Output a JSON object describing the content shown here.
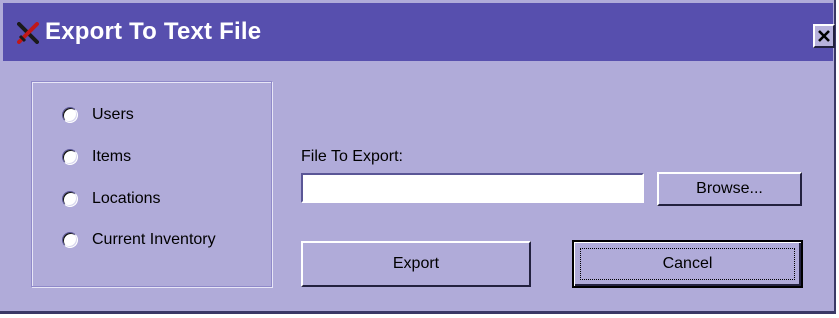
{
  "window": {
    "title": "Export To Text File",
    "title_icon": "crossed-tools-icon",
    "close_icon": "close-icon",
    "colors": {
      "titlebar": "#574fae",
      "body": "#b0abd9"
    }
  },
  "options": {
    "items": [
      {
        "label": "Users",
        "selected": false
      },
      {
        "label": "Items",
        "selected": false
      },
      {
        "label": "Locations",
        "selected": false
      },
      {
        "label": "Current Inventory",
        "selected": false
      }
    ]
  },
  "file": {
    "label": "File To Export:",
    "value": "",
    "browse_label": "Browse..."
  },
  "actions": {
    "export_label": "Export",
    "cancel_label": "Cancel"
  }
}
